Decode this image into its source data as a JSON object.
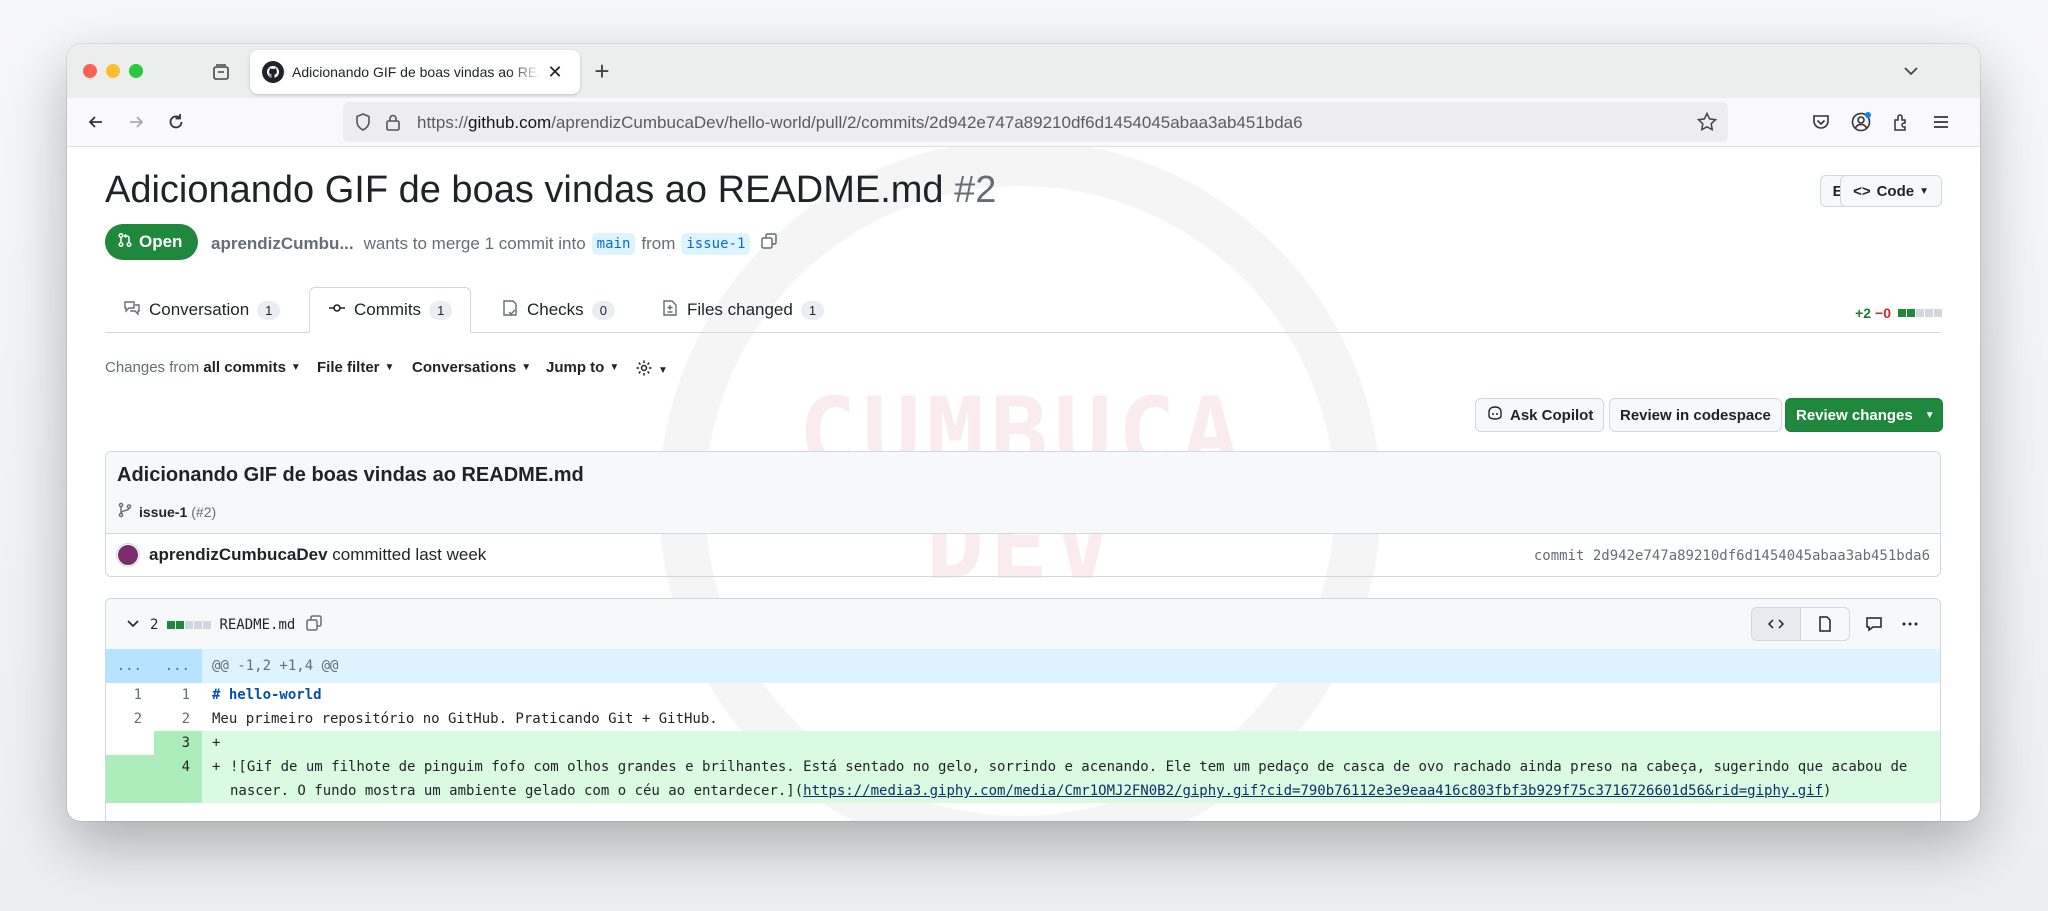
{
  "browser": {
    "tab_title": "Adicionando GIF de boas vindas ao README.md - aprendizCumbucaDev/hello-world",
    "url_prefix": "https://",
    "url_host": "github.com",
    "url_path": "/aprendizCumbucaDev/hello-world/pull/2/commits/2d942e747a89210df6d1454045abaa3ab451bda6"
  },
  "watermark": "CUMBUCA DEV",
  "pr": {
    "title": "Adicionando GIF de boas vindas ao README.md",
    "number": "#2",
    "edit_label": "Edit",
    "code_label": "Code",
    "state": "Open",
    "author": "aprendizCumbu...",
    "merge_text": "wants to merge 1 commit into",
    "base_branch": "main",
    "from_text": "from",
    "head_branch": "issue-1"
  },
  "tabs": [
    {
      "label": "Conversation",
      "count": "1"
    },
    {
      "label": "Commits",
      "count": "1"
    },
    {
      "label": "Checks",
      "count": "0"
    },
    {
      "label": "Files changed",
      "count": "1"
    }
  ],
  "diffstat": {
    "additions": "+2",
    "deletions": "−0"
  },
  "toolbar": {
    "changes_prefix": "Changes from",
    "changes_value": "all commits",
    "file_filter": "File filter",
    "conversations": "Conversations",
    "jump_to": "Jump to",
    "ask_copilot": "Ask Copilot",
    "review_codespace": "Review in codespace",
    "review_changes": "Review changes"
  },
  "commit": {
    "title": "Adicionando GIF de boas vindas ao README.md",
    "branch": "issue-1",
    "pr_ref": "(#2)",
    "author": "aprendizCumbucaDev",
    "when": "committed last week",
    "sha_label": "commit 2d942e747a89210df6d1454045abaa3ab451bda6"
  },
  "file": {
    "changes": "2",
    "name": "README.md",
    "hunk": "@@ -1,2 +1,4 @@",
    "lines": [
      {
        "old": "1",
        "new": "1",
        "type": "ctx",
        "text": "# hello-world"
      },
      {
        "old": "2",
        "new": "2",
        "type": "ctx",
        "text": "Meu primeiro repositório no GitHub. Praticando Git + GitHub."
      },
      {
        "old": "",
        "new": "3",
        "type": "add",
        "text": ""
      },
      {
        "old": "",
        "new": "4",
        "type": "add",
        "text": "![Gif de um filhote de pinguim fofo com olhos grandes e brilhantes. Está sentado no gelo, sorrindo e acenando. Ele tem um pedaço de casca de ovo rachado ainda preso na cabeça, sugerindo que acabou de nascer. O fundo mostra um ambiente gelado com o céu ao entardecer.](",
        "link": "https://media3.giphy.com/media/Cmr1OMJ2FN0B2/giphy.gif?cid=790b76112e3e9eaa416c803fbf3b929f75c3716726601d56&rid=giphy.gif",
        "tail": ")"
      }
    ]
  },
  "colors": {
    "accent_green": "#1f883d",
    "link_blue": "#0969da"
  }
}
